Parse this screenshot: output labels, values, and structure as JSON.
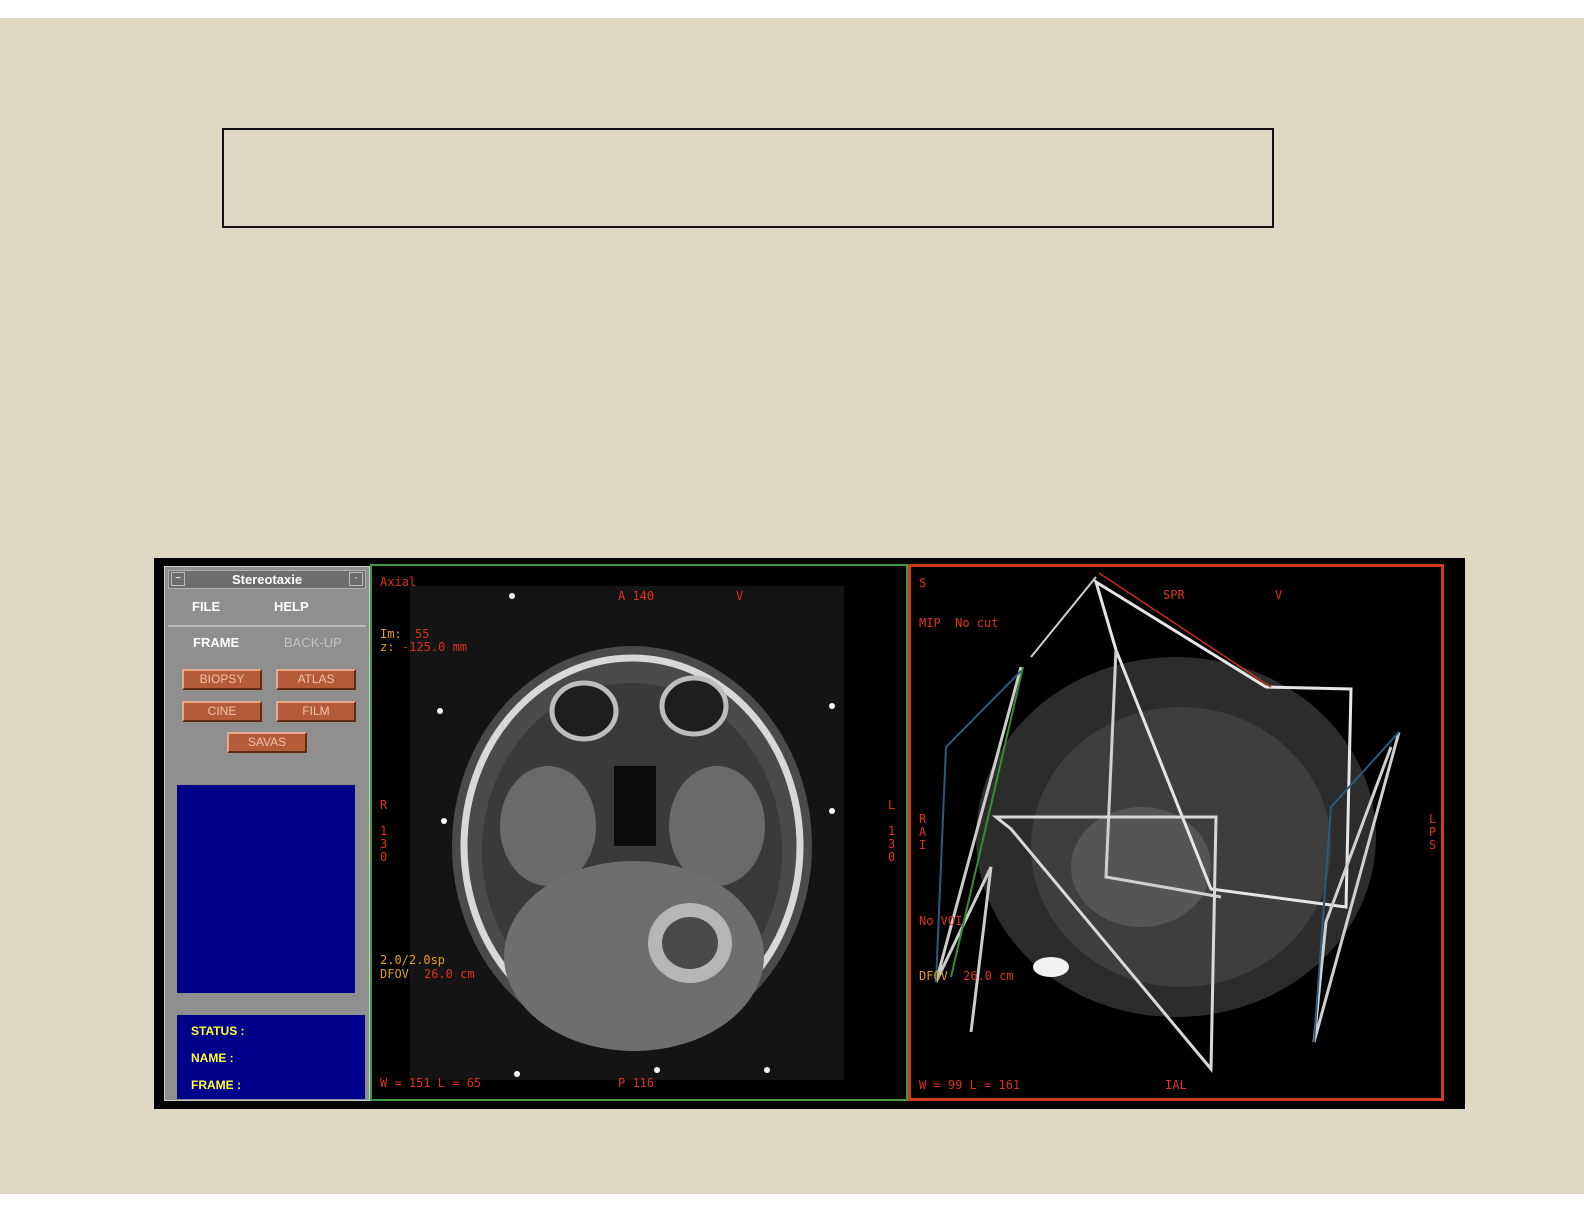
{
  "app": {
    "window_title": "Stereotaxie",
    "menu": [
      "FILE",
      "HELP"
    ],
    "modes": {
      "frame": "FRAME",
      "backup": "BACK-UP"
    },
    "buttons": {
      "biopsy": "BIOPSY",
      "atlas": "ATLAS",
      "cine": "CINE",
      "film": "FILM",
      "savas": "SAVAS"
    },
    "status": {
      "status": "STATUS :",
      "name": "NAME :",
      "frame": "FRAME :"
    }
  },
  "axial_view": {
    "plane": "Axial",
    "top": "A 140",
    "top_right": "V",
    "image_label": "Im:",
    "image_value": "55",
    "z_label": "z:",
    "z_value": "-125.0 mm",
    "left_side": "R",
    "left_dist": "130",
    "right_side": "L",
    "right_dist": "130",
    "thickness": "2.0/2.0sp",
    "dfov_label": "DFOV",
    "dfov_value": "26.0 cm",
    "window_level": "W = 151 L = 65",
    "bottom": "P 116"
  },
  "render_view": {
    "top_left": "S",
    "mode": "MIP  No cut",
    "orientation": "SPR",
    "top_right": "V",
    "left_label": "RAI",
    "right_label": "LPS",
    "voi": "No VOI",
    "dfov_label": "DFOV",
    "dfov_value": "26.0 cm",
    "window_level": "W = 99 L = 161",
    "bottom": "IAL"
  },
  "colors": {
    "slide_bg": "#dfd9c3",
    "panel_gray": "#8f8f8f",
    "button_rust": "#b45c3a",
    "status_navy": "#00008a",
    "overlay_red": "#e0301c",
    "overlay_yellow": "#e0a020",
    "axial_border": "#3c9a3c",
    "render_border": "#d23a18"
  }
}
